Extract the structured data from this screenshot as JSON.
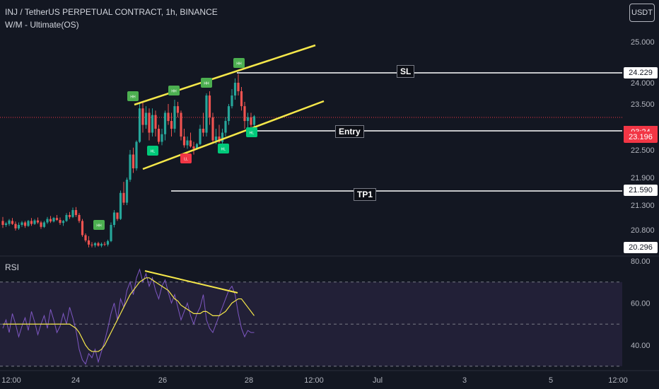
{
  "header": {
    "title": "INJ / TetherUS PERPETUAL CONTRACT, 1h, BINANCE",
    "indicator": "W/M - Ultimate(OS)",
    "currency_button": "USDT"
  },
  "colors": {
    "background": "#131722",
    "up_candle": "#26a69a",
    "down_candle": "#ef5350",
    "channel": "#f5e74a",
    "rsi_line": "#7e57c2",
    "rsi_ma": "#f5e74a",
    "rsi_band": "#2a2540",
    "label_up": "#4caf50",
    "label_hl": "#00c97a",
    "label_ll": "#f23645"
  },
  "levels": {
    "sl": {
      "label": "SL",
      "price_label": "24.229",
      "value": 24.229
    },
    "entry": {
      "label": "Entry",
      "price_label": "22.896",
      "value": 22.896
    },
    "tp1": {
      "label": "TP1",
      "price_label": "21.590",
      "value": 21.59
    },
    "last_price": {
      "price_label": "23.196",
      "countdown": "03:24",
      "value": 23.196
    },
    "low_marker": {
      "price_label": "20.296",
      "value": 20.296
    }
  },
  "chart_data": [
    {
      "type": "candlestick",
      "title": "INJ / TetherUS PERPETUAL CONTRACT, 1h, BINANCE",
      "y_ticks": [
        "25.000",
        "24.000",
        "23.500",
        "22.500",
        "21.900",
        "21.300",
        "20.800"
      ],
      "x_ticks": [
        "12:00",
        "24",
        "26",
        "28",
        "12:00",
        "Jul",
        "3",
        "5",
        "12:00"
      ],
      "ylim": [
        20.2,
        25.2
      ],
      "grid": false,
      "series": [
        {
          "ohlc": [
            [
              20.98,
              21.06,
              20.84,
              20.9
            ],
            [
              20.9,
              20.96,
              20.86,
              20.93
            ],
            [
              20.92,
              21.02,
              20.88,
              20.99
            ],
            [
              20.98,
              21.04,
              20.9,
              20.92
            ],
            [
              20.92,
              20.97,
              20.78,
              20.83
            ],
            [
              20.83,
              20.95,
              20.8,
              20.9
            ],
            [
              20.9,
              20.98,
              20.86,
              20.95
            ],
            [
              20.95,
              20.98,
              20.84,
              20.88
            ],
            [
              20.88,
              21.0,
              20.86,
              20.98
            ],
            [
              20.98,
              21.04,
              20.88,
              20.92
            ],
            [
              20.92,
              21.02,
              20.9,
              20.99
            ],
            [
              20.99,
              21.05,
              20.92,
              20.95
            ],
            [
              20.95,
              20.98,
              20.82,
              20.86
            ],
            [
              20.86,
              20.98,
              20.84,
              20.95
            ],
            [
              20.95,
              21.06,
              20.92,
              21.02
            ],
            [
              21.02,
              21.08,
              20.94,
              20.97
            ],
            [
              20.97,
              21.06,
              20.95,
              21.04
            ],
            [
              21.04,
              21.1,
              20.98,
              21.0
            ],
            [
              21.0,
              21.05,
              20.9,
              20.94
            ],
            [
              20.94,
              21.0,
              20.88,
              20.98
            ],
            [
              20.98,
              21.14,
              20.96,
              21.1
            ],
            [
              21.1,
              21.16,
              21.02,
              21.06
            ],
            [
              21.06,
              21.25,
              21.04,
              21.2
            ],
            [
              21.2,
              21.26,
              21.06,
              21.1
            ],
            [
              21.1,
              21.14,
              20.94,
              20.98
            ],
            [
              20.98,
              21.02,
              20.6,
              20.65
            ],
            [
              20.65,
              20.7,
              20.45,
              20.5
            ],
            [
              20.5,
              20.62,
              20.3,
              20.38
            ],
            [
              20.38,
              20.45,
              20.3,
              20.36
            ],
            [
              20.36,
              20.45,
              20.3,
              20.42
            ],
            [
              20.42,
              20.46,
              20.32,
              20.35
            ],
            [
              20.35,
              20.44,
              20.3,
              20.4
            ],
            [
              20.4,
              20.46,
              20.34,
              20.38
            ],
            [
              20.38,
              20.52,
              20.33,
              20.48
            ],
            [
              20.48,
              20.95,
              20.45,
              20.9
            ],
            [
              20.9,
              21.2,
              20.85,
              21.15
            ],
            [
              21.15,
              21.1,
              20.98,
              21.02
            ],
            [
              21.02,
              21.6,
              21.0,
              21.55
            ],
            [
              21.55,
              21.8,
              21.3,
              21.35
            ],
            [
              21.35,
              21.9,
              21.3,
              21.85
            ],
            [
              21.85,
              22.5,
              21.8,
              22.4
            ],
            [
              22.4,
              22.6,
              22.0,
              22.1
            ],
            [
              22.1,
              22.9,
              22.05,
              22.85
            ],
            [
              22.85,
              23.5,
              22.8,
              23.4
            ],
            [
              23.4,
              23.55,
              23.0,
              23.1
            ],
            [
              23.1,
              23.45,
              23.05,
              23.3
            ],
            [
              23.3,
              23.4,
              22.9,
              23.0
            ],
            [
              23.0,
              23.4,
              22.95,
              23.25
            ],
            [
              23.25,
              23.35,
              22.95,
              23.05
            ],
            [
              23.05,
              23.1,
              22.75,
              22.85
            ],
            [
              22.85,
              23.05,
              22.7,
              22.98
            ],
            [
              22.98,
              23.35,
              22.9,
              23.3
            ],
            [
              23.3,
              23.5,
              23.1,
              23.15
            ],
            [
              23.15,
              23.3,
              22.95,
              23.05
            ],
            [
              23.05,
              23.6,
              23.0,
              23.45
            ],
            [
              23.45,
              23.55,
              23.2,
              23.3
            ],
            [
              23.3,
              23.35,
              22.9,
              22.95
            ],
            [
              22.95,
              23.05,
              22.6,
              22.7
            ],
            [
              22.7,
              22.95,
              22.55,
              22.9
            ],
            [
              22.9,
              23.0,
              22.6,
              22.65
            ],
            [
              22.65,
              22.85,
              22.4,
              22.55
            ],
            [
              22.55,
              22.8,
              22.5,
              22.75
            ],
            [
              22.75,
              23.1,
              22.7,
              23.05
            ],
            [
              23.05,
              23.3,
              22.95,
              23.0
            ],
            [
              23.0,
              23.75,
              22.95,
              23.7
            ],
            [
              23.7,
              23.8,
              23.1,
              23.2
            ],
            [
              23.2,
              23.3,
              22.85,
              22.9
            ],
            [
              22.9,
              23.05,
              22.75,
              22.95
            ],
            [
              22.95,
              23.1,
              22.8,
              22.85
            ],
            [
              22.85,
              23.05,
              22.7,
              23.0
            ],
            [
              23.0,
              23.2,
              22.95,
              23.15
            ],
            [
              23.15,
              23.5,
              23.1,
              23.45
            ],
            [
              23.45,
              23.85,
              23.4,
              23.7
            ],
            [
              23.7,
              24.1,
              23.6,
              24.0
            ],
            [
              24.0,
              24.2,
              23.7,
              23.8
            ],
            [
              23.8,
              23.9,
              23.35,
              23.45
            ],
            [
              23.45,
              23.55,
              23.05,
              23.15
            ],
            [
              23.15,
              23.3,
              23.0,
              23.2
            ],
            [
              23.2,
              23.3,
              23.05,
              23.1
            ],
            [
              23.1,
              23.25,
              23.05,
              23.22
            ]
          ]
        }
      ],
      "annotations": [
        "HH",
        "HH",
        "HH",
        "HH",
        "HH",
        "HL",
        "LL",
        "HL",
        "HL"
      ]
    },
    {
      "type": "line",
      "title": "RSI",
      "y_ticks": [
        "80.00",
        "60.00",
        "40.00"
      ],
      "ylim": [
        30,
        84
      ],
      "band": [
        70,
        30
      ],
      "midline": 50,
      "series": [
        {
          "values": [
            48,
            52,
            46,
            55,
            50,
            44,
            49,
            53,
            47,
            56,
            51,
            45,
            50,
            54,
            48,
            57,
            52,
            46,
            49,
            55,
            50,
            58,
            53,
            47,
            38,
            33,
            31,
            36,
            34,
            38,
            32,
            37,
            42,
            48,
            55,
            60,
            52,
            62,
            58,
            66,
            70,
            64,
            72,
            76,
            70,
            74,
            68,
            72,
            66,
            62,
            68,
            71,
            65,
            60,
            64,
            58,
            52,
            56,
            60,
            54,
            50,
            55,
            58,
            64,
            52,
            48,
            46,
            50,
            54,
            58,
            62,
            66,
            68,
            64,
            55,
            48,
            44,
            47,
            46,
            46
          ],
          "color": "#7e57c2"
        },
        {
          "values": [
            50,
            50,
            50,
            50,
            50,
            50,
            50,
            50,
            50,
            50,
            50,
            50,
            50,
            50,
            50,
            50,
            50,
            50,
            50,
            50,
            50,
            50,
            49,
            48,
            46,
            43,
            40,
            38,
            37,
            37,
            37,
            38,
            40,
            43,
            46,
            49,
            52,
            55,
            58,
            61,
            64,
            66,
            68,
            70,
            71,
            72,
            72,
            71,
            70,
            69,
            68,
            67,
            66,
            64,
            62,
            61,
            59,
            58,
            57,
            56,
            55,
            55,
            55,
            56,
            56,
            55,
            54,
            54,
            54,
            55,
            56,
            58,
            60,
            61,
            62,
            62,
            60,
            58,
            56,
            54
          ],
          "color": "#f5e74a"
        }
      ]
    }
  ]
}
